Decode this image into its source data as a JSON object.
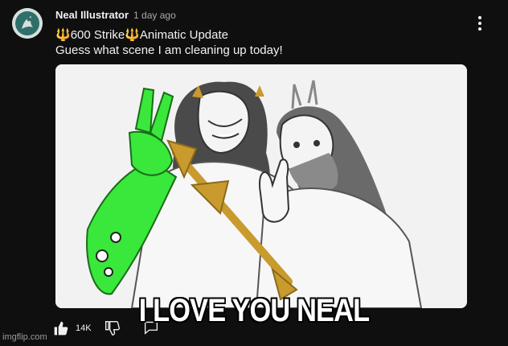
{
  "post": {
    "channel": "Neal Illustrator",
    "time": "1 day ago",
    "title_part1": "600 Strike",
    "title_part2": "Animatic Update",
    "title_icon": "🔱",
    "body": "Guess what scene I am cleaning up today!",
    "avatar_icon": "mermaid-avatar-icon",
    "image_alt": "sketch of two bearded sea gods with a golden trident and a green-gloved hand making a peace sign"
  },
  "actions": {
    "like_count": "14K",
    "like_icon": "thumbs-up-icon",
    "dislike_icon": "thumbs-down-icon",
    "comment_icon": "comment-icon",
    "menu_icon": "more-vert-icon"
  },
  "meme": {
    "caption": "I LOVE YOU NEAL",
    "watermark": "imgflip.com"
  },
  "colors": {
    "background": "#0f0f0f",
    "trident": "#c99a2e",
    "glove": "#39e83a"
  }
}
